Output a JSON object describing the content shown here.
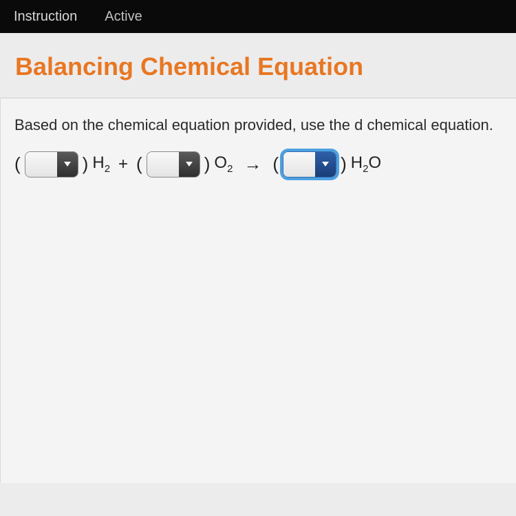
{
  "header": {
    "tab_instruction": "Instruction",
    "tab_active": "Active"
  },
  "title": "Balancing Chemical Equation",
  "prompt": "Based on the chemical equation provided, use the d chemical equation.",
  "equation": {
    "lparen": "(",
    "rparen": ")",
    "plus": "+",
    "arrow": "→",
    "term1_base": "H",
    "term1_sub": "2",
    "term2_base": "O",
    "term2_sub": "2",
    "term3_base1": "H",
    "term3_sub": "2",
    "term3_base2": "O",
    "coef1": "",
    "coef2": "",
    "coef3": ""
  }
}
